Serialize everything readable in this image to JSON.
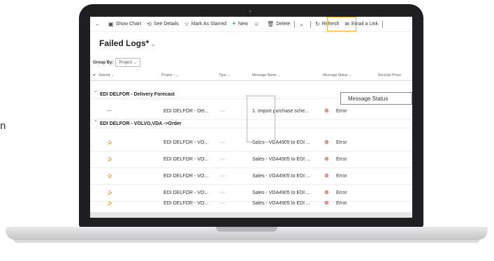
{
  "partial_letter": "n",
  "commandbar": {
    "back_glyph": "←",
    "items": [
      {
        "icon": "chart-icon",
        "glyph": "▣",
        "label": "Show Chart"
      },
      {
        "icon": "details-icon",
        "glyph": "⟲",
        "label": "See Details"
      },
      {
        "icon": "star-icon",
        "glyph": "☆",
        "label": "Mark As Starred"
      },
      {
        "icon": "plus-icon",
        "glyph": "+",
        "label": "New"
      },
      {
        "icon": "smiley-icon",
        "glyph": "☺",
        "label": ""
      },
      {
        "icon": "trash-icon",
        "glyph": "🗑",
        "label": "Delete"
      },
      {
        "icon": "chevron-down-icon",
        "glyph": "⌄",
        "label": ""
      },
      {
        "icon": "refresh-icon",
        "glyph": "↻",
        "label": "Refresh"
      },
      {
        "icon": "email-icon",
        "glyph": "✉",
        "label": "Email a Link"
      }
    ]
  },
  "view": {
    "title": "Failed Logs*",
    "chevron": "⌄"
  },
  "groupby": {
    "label": "Group By:",
    "value": "Project",
    "chevron": "⌄"
  },
  "columns": {
    "check": "✔",
    "starred": "Starred ⌄",
    "project": "Project ↑ ⌄",
    "type": "Type ⌄",
    "message_name": "Message Name ⌄",
    "message_status": "Message Status ⌄",
    "records": "Records Proce"
  },
  "tooltip": "Message Status",
  "groups": [
    {
      "chevron": "⌄",
      "name": "EDI DELFOR - Delivery Forecast",
      "rows": [
        {
          "starred": "---",
          "project": "EDI DELFOR - Del...",
          "type": "···",
          "message": "1. Import purchase sche...",
          "status_icon": "⊗",
          "status": "Error"
        }
      ]
    },
    {
      "chevron": "⌄",
      "name": "EDI DELFOR - VOLVO,VDA ->Order",
      "rows": [
        {
          "starred": "✰",
          "project": "EDI DELFOR - VO...",
          "type": "···",
          "message": "Sales - VDA4905 to EDI ...",
          "status_icon": "⊗",
          "status": "Error"
        },
        {
          "starred": "✰",
          "project": "EDI DELFOR - VO...",
          "type": "···",
          "message": "Sales - VDA4905 to EDI ...",
          "status_icon": "⊗",
          "status": "Error"
        },
        {
          "starred": "✰",
          "project": "EDI DELFOR - VO...",
          "type": "···",
          "message": "Sales - VDA4905 to EDI ...",
          "status_icon": "⊗",
          "status": "Error"
        },
        {
          "starred": "✰",
          "project": "EDI DELFOR - VO...",
          "type": "···",
          "message": "Sales - VDA4905 to EDI ...",
          "status_icon": "⊗",
          "status": "Error"
        },
        {
          "starred": "✰",
          "project": "EDI DELFOR - VO...",
          "type": "···",
          "message": "Sales - VDA4905 to EDI ...",
          "status_icon": "⊗",
          "status": "Error"
        }
      ]
    }
  ],
  "colors": {
    "highlight": "#f0b43b",
    "error": "#d92d2d",
    "star": "#c89b12",
    "new_plus": "#1b8f3a"
  }
}
